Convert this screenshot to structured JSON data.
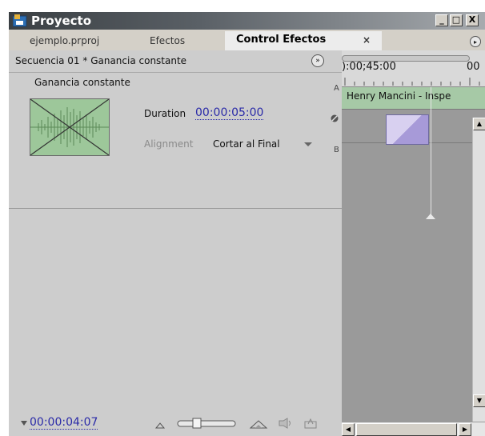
{
  "window": {
    "title": "Proyecto",
    "minimize_label": "_",
    "maximize_label": "□",
    "close_label": "X"
  },
  "tabs": [
    {
      "label": "ejemplo.prproj",
      "active": false
    },
    {
      "label": "Efectos",
      "active": false
    },
    {
      "label": "Control Efectos",
      "active": true
    }
  ],
  "tab_close_glyph": "×",
  "panel_menu_glyph": "▸",
  "sequence": {
    "label": "Secuencia 01 * Ganancia constante",
    "toggle_glyph": "»"
  },
  "effect": {
    "name": "Ganancia constante",
    "duration_label": "Duration",
    "duration_value": "00:00:05:00",
    "alignment_label": "Alignment",
    "alignment_value": "Cortar al Final",
    "marker_a": "A",
    "marker_b": "B"
  },
  "timeline": {
    "ruler_timecode": "):00;45:00",
    "ruler_timecode_right": "00",
    "clip_label": "Henry Mancini - Inspe"
  },
  "footer": {
    "current_timecode": "00:00:04:07"
  },
  "icons": [
    "app-icon",
    "zoom-out-icon",
    "zoom-slider-icon",
    "zoom-in-icon",
    "loop-audio-icon",
    "export-icon",
    "scroll-left-icon",
    "scroll-right-icon",
    "scroll-up-icon",
    "scroll-down-icon"
  ],
  "colors": {
    "titlebar": "#3a3f43",
    "timecode_blue": "#2a2aa8",
    "clip_green": "#a6c9a6",
    "keyframe_purple": "#a79ad8",
    "panel_gray": "#cdcdcd",
    "timeline_gray": "#9a9a9a"
  }
}
